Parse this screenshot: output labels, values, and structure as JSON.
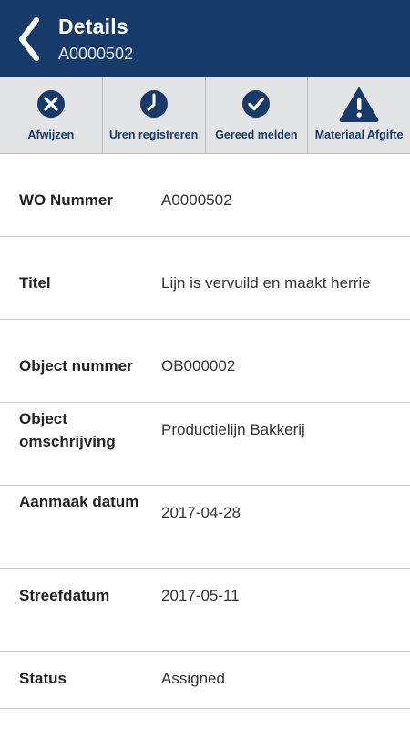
{
  "header": {
    "title": "Details",
    "subtitle": "A0000502",
    "background": "#163b6b"
  },
  "toolbar": {
    "items": [
      {
        "label": "Afwijzen",
        "icon": "close-circle-icon"
      },
      {
        "label": "Uren registreren",
        "icon": "clock-icon"
      },
      {
        "label": "Gereed melden",
        "icon": "check-circle-icon"
      },
      {
        "label": "Materiaal Afgifte",
        "icon": "warning-icon"
      }
    ]
  },
  "details": {
    "rows": [
      {
        "label": "WO Nummer",
        "value": "A0000502"
      },
      {
        "label": "Titel",
        "value": "Lijn is vervuild en maakt herrie"
      },
      {
        "label": "Object nummer",
        "value": "OB000002"
      },
      {
        "label": "Object omschrijving",
        "value": "Productielijn Bakkerij"
      },
      {
        "label": "Aanmaak datum",
        "value": "2017-04-28"
      },
      {
        "label": "Streefdatum",
        "value": "2017-05-11"
      },
      {
        "label": "Status",
        "value": "Assigned"
      }
    ]
  }
}
